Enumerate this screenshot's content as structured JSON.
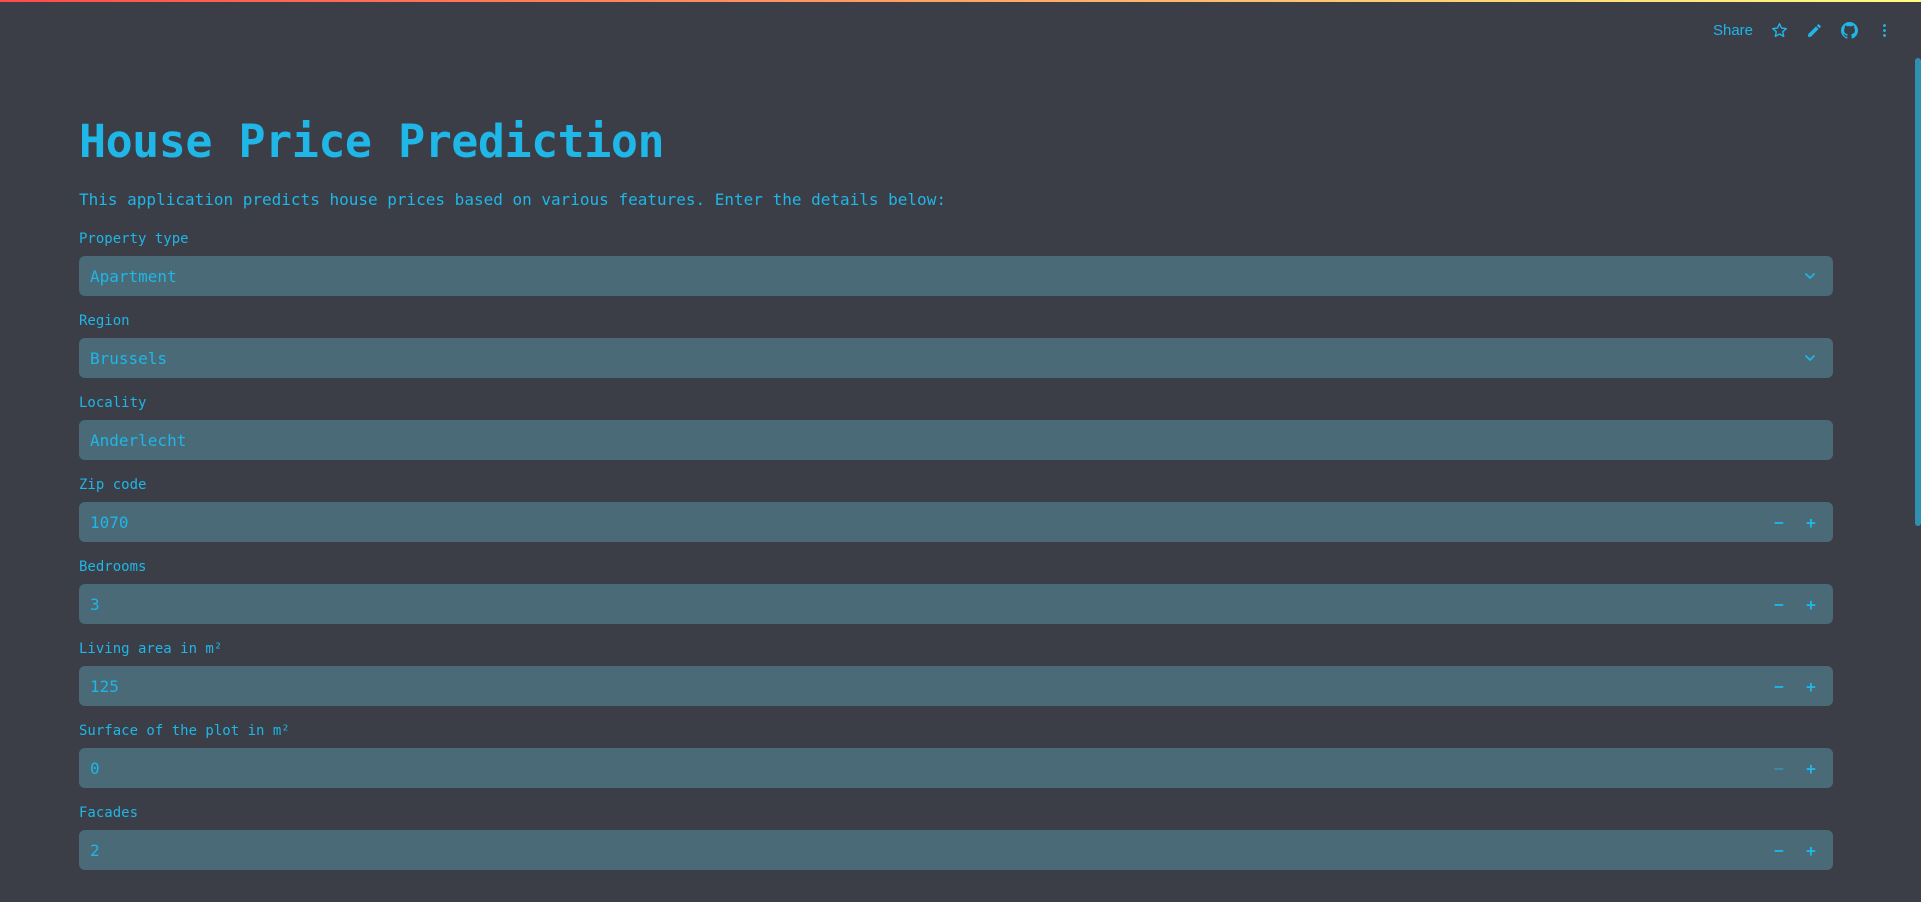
{
  "toolbar": {
    "share_label": "Share",
    "icons": [
      "star-icon",
      "pencil-icon",
      "github-icon",
      "more-vertical-icon"
    ]
  },
  "main": {
    "title": "House Price Prediction",
    "subtitle": "This application predicts house prices based on various features. Enter the details below:"
  },
  "fields": {
    "property_type": {
      "label": "Property type",
      "value": "Apartment"
    },
    "region": {
      "label": "Region",
      "value": "Brussels"
    },
    "locality": {
      "label": "Locality",
      "value": "Anderlecht"
    },
    "zip_code": {
      "label": "Zip code",
      "value": "1070"
    },
    "bedrooms": {
      "label": "Bedrooms",
      "value": "3"
    },
    "living_area": {
      "label": "Living area in m²",
      "value": "125"
    },
    "plot_surface": {
      "label": "Surface of the plot in m²",
      "value": "0"
    },
    "facades": {
      "label": "Facades",
      "value": "2"
    }
  },
  "stepper": {
    "minus": "−",
    "plus": "+"
  },
  "colors": {
    "background": "#3b3e47",
    "accent": "#1fb6e8",
    "input_bg": "#4a6a78"
  }
}
